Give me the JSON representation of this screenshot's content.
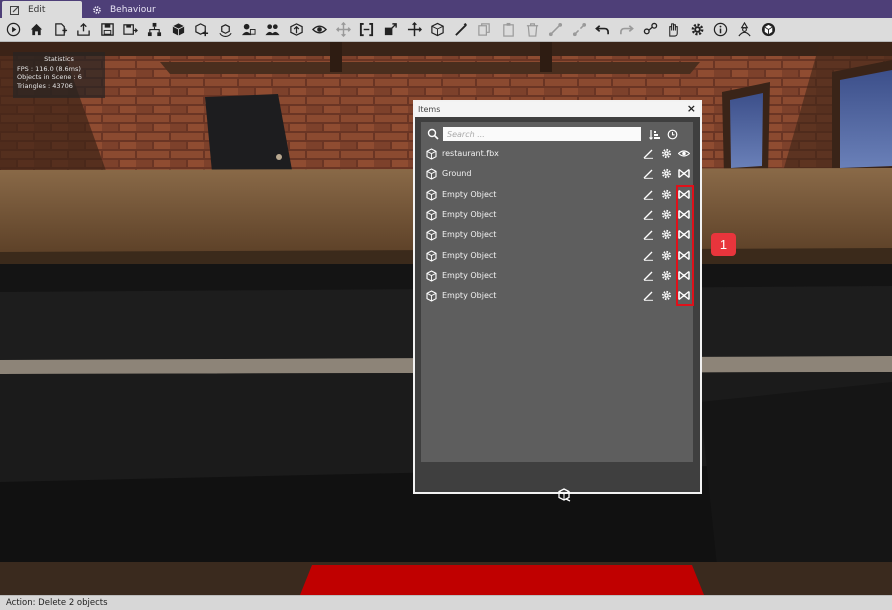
{
  "tabs": [
    {
      "label": "Edit",
      "icon": "edit-icon",
      "active": true
    },
    {
      "label": "Behaviour",
      "icon": "gear-icon",
      "active": false
    }
  ],
  "toolbar": {
    "buttons": [
      "play-icon",
      "home-icon",
      "add-page-icon",
      "import-icon",
      "save-icon",
      "save-as-icon",
      "hierarchy-icon",
      "cube-icon",
      "cube-add-icon",
      "cube-rotate-icon",
      "user-cube-icon",
      "users-icon",
      "cube-up-icon",
      "eye-icon",
      "move-icon",
      "brackets-icon",
      "scale-icon",
      "axis-icon",
      "box-icon",
      "wand-icon",
      "copy-icon",
      "paste-icon",
      "trash-icon",
      "link-icon",
      "unlink-icon",
      "undo-icon",
      "redo-icon",
      "network-icon",
      "hand-icon",
      "settings-icon",
      "info-icon",
      "person-icon",
      "logo-icon"
    ]
  },
  "statistics": {
    "title": "Statistics",
    "fps": "FPS : 116.0 (8.6ms)",
    "objects": "Objects in Scene : 6",
    "triangles": "Triangles : 43706"
  },
  "items_window": {
    "title": "Items",
    "close": "×",
    "search_placeholder": "Search ...",
    "items": [
      {
        "name": "restaurant.fbx",
        "visibility": "eye-icon"
      },
      {
        "name": "Ground",
        "visibility": "hidden-icon"
      },
      {
        "name": "Empty Object",
        "visibility": "hidden-icon"
      },
      {
        "name": "Empty Object",
        "visibility": "hidden-icon"
      },
      {
        "name": "Empty Object",
        "visibility": "hidden-icon"
      },
      {
        "name": "Empty Object",
        "visibility": "hidden-icon"
      },
      {
        "name": "Empty Object",
        "visibility": "hidden-icon"
      },
      {
        "name": "Empty Object",
        "visibility": "hidden-icon"
      }
    ]
  },
  "annotation": {
    "label": "1",
    "color": "#e8353c",
    "highlight_color": "#e0101a"
  },
  "status": {
    "text": "Action: Delete 2 objects"
  },
  "colors": {
    "tabbar": "#4e3f78",
    "toolbar": "#dcdcdc",
    "panel": "#5e5e5e",
    "floor_accent": "#c00000"
  }
}
